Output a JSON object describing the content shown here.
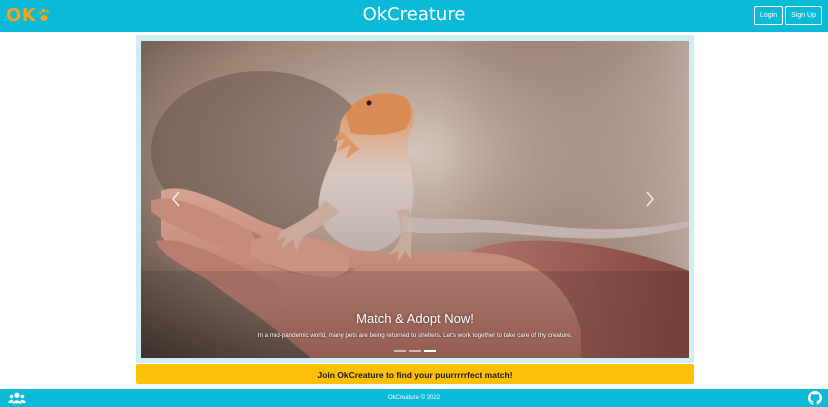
{
  "header": {
    "logo_text": "OK",
    "logo_icon": "paw-print-icon",
    "title": "OkCreature",
    "login_label": "Login",
    "signup_label": "Sign Up"
  },
  "carousel": {
    "slide_image": "bearded-dragon-on-hand-photo",
    "caption_title": "Match & Adopt Now!",
    "caption_text": "In a mid-pandemic world, many pets are being returned to shelters. Let's work together to take care of thy creature.",
    "prev_icon": "chevron-left-icon",
    "next_icon": "chevron-right-icon",
    "slide_count": 3,
    "active_slide": 3
  },
  "cta": {
    "label": "Join OkCreature to find your puurrrrrfect match!"
  },
  "footer": {
    "copyright": "OkCreature © 2022",
    "left_icon": "users-icon",
    "right_icon": "github-icon"
  },
  "colors": {
    "brand_teal": "#0bbad6",
    "logo_orange": "#f5a21b",
    "paw_green": "#7cc242",
    "cta_yellow": "#fdc008",
    "carousel_frame": "#cdeff3"
  }
}
